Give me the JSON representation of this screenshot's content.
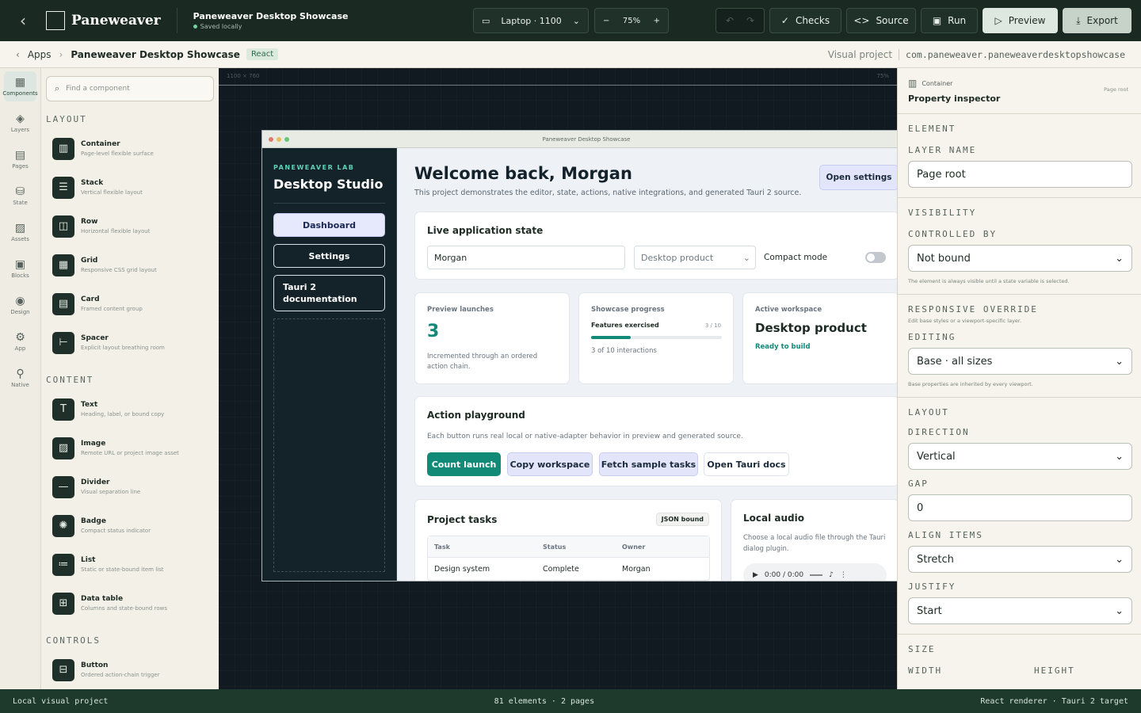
{
  "topbar": {
    "brand": "Paneweaver",
    "project_title": "Paneweaver Desktop Showcase",
    "save_status": "Saved locally",
    "viewport_select": "Laptop · 1100",
    "zoom": "75%",
    "checks_label": "Checks",
    "source_label": "Source",
    "run_label": "Run",
    "preview_label": "Preview",
    "export_label": "Export"
  },
  "crumbs": {
    "apps": "Apps",
    "project": "Paneweaver Desktop Showcase",
    "framework_tag": "React",
    "kind": "Visual project",
    "bundle_id": "com.paneweaver.paneweaverdesktopshowcase"
  },
  "rail": [
    {
      "icon": "components-icon",
      "label": "Components"
    },
    {
      "icon": "layers-icon",
      "label": "Layers"
    },
    {
      "icon": "pages-icon",
      "label": "Pages"
    },
    {
      "icon": "state-icon",
      "label": "State"
    },
    {
      "icon": "assets-icon",
      "label": "Assets"
    },
    {
      "icon": "blocks-icon",
      "label": "Blocks"
    },
    {
      "icon": "design-icon",
      "label": "Design"
    },
    {
      "icon": "app-icon",
      "label": "App"
    },
    {
      "icon": "native-icon",
      "label": "Native"
    }
  ],
  "palette": {
    "search_placeholder": "Find a component",
    "sections": [
      {
        "title": "LAYOUT",
        "items": [
          {
            "name": "Container",
            "desc": "Page-level flexible surface",
            "icon": "container-icon"
          },
          {
            "name": "Stack",
            "desc": "Vertical flexible layout",
            "icon": "stack-icon"
          },
          {
            "name": "Row",
            "desc": "Horizontal flexible layout",
            "icon": "row-icon"
          },
          {
            "name": "Grid",
            "desc": "Responsive CSS grid layout",
            "icon": "grid-icon"
          },
          {
            "name": "Card",
            "desc": "Framed content group",
            "icon": "card-icon"
          },
          {
            "name": "Spacer",
            "desc": "Explicit layout breathing room",
            "icon": "spacer-icon"
          }
        ]
      },
      {
        "title": "CONTENT",
        "items": [
          {
            "name": "Text",
            "desc": "Heading, label, or bound copy",
            "icon": "text-icon"
          },
          {
            "name": "Image",
            "desc": "Remote URL or project image asset",
            "icon": "image-icon"
          },
          {
            "name": "Divider",
            "desc": "Visual separation line",
            "icon": "divider-icon"
          },
          {
            "name": "Badge",
            "desc": "Compact status indicator",
            "icon": "badge-icon"
          },
          {
            "name": "List",
            "desc": "Static or state-bound item list",
            "icon": "list-icon"
          },
          {
            "name": "Data table",
            "desc": "Columns and state-bound rows",
            "icon": "table-icon"
          }
        ]
      },
      {
        "title": "CONTROLS",
        "items": [
          {
            "name": "Button",
            "desc": "Ordered action-chain trigger",
            "icon": "button-icon"
          }
        ]
      }
    ]
  },
  "canvas": {
    "size_label": "1100 × 760",
    "zoom_label": "75%",
    "window_title": "Paneweaver Desktop Showcase",
    "sidebar": {
      "eyebrow": "PANEWEAVER LAB",
      "title": "Desktop Studio",
      "nav": [
        "Dashboard",
        "Settings",
        "Tauri 2 documentation"
      ]
    },
    "header": {
      "title": "Welcome back, Morgan",
      "subtitle": "This project demonstrates the editor, state, actions, native integrations, and generated Tauri 2 source.",
      "settings_button": "Open settings"
    },
    "live_state": {
      "title": "Live application state",
      "name_value": "Morgan",
      "product_select": "Desktop product",
      "compact_label": "Compact mode",
      "compact_on": false
    },
    "stats": {
      "launches_label": "Preview launches",
      "launches_value": "3",
      "launches_desc": "Incremented through an ordered action chain.",
      "progress_label": "Showcase progress",
      "features_label": "Features exercised",
      "progress_value": "3 / 10",
      "progress_fraction": 0.3,
      "progress_desc": "3 of 10 interactions",
      "workspace_label": "Active workspace",
      "workspace_value": "Desktop product",
      "workspace_status": "Ready to build"
    },
    "actions": {
      "title": "Action playground",
      "desc": "Each button runs real local or native-adapter behavior in preview and generated source.",
      "buttons": [
        "Count launch",
        "Copy workspace",
        "Fetch sample tasks",
        "Open Tauri docs"
      ]
    },
    "tasks": {
      "title": "Project tasks",
      "badge": "JSON bound",
      "columns": [
        "Task",
        "Status",
        "Owner"
      ],
      "rows": [
        [
          "Design system",
          "Complete",
          "Morgan"
        ]
      ]
    },
    "audio": {
      "title": "Local audio",
      "desc": "Choose a local audio file through the Tauri dialog plugin.",
      "time": "0:00 / 0:00"
    }
  },
  "inspector": {
    "kind": "Container",
    "title": "Property inspector",
    "scope": "Page root",
    "element_label": "ELEMENT",
    "layer_name_label": "LAYER NAME",
    "layer_name_value": "Page root",
    "visibility_label": "VISIBILITY",
    "controlled_by_label": "CONTROLLED BY",
    "controlled_by_value": "Not bound",
    "visibility_hint": "The element is always visible until a state variable is selected.",
    "responsive_label": "RESPONSIVE OVERRIDE",
    "responsive_hint": "Edit base styles or a viewport-specific layer.",
    "editing_label": "EDITING",
    "editing_value": "Base · all sizes",
    "editing_hint": "Base properties are inherited by every viewport.",
    "layout_label": "LAYOUT",
    "direction_label": "DIRECTION",
    "direction_value": "Vertical",
    "gap_label": "GAP",
    "gap_value": "0",
    "align_label": "ALIGN ITEMS",
    "align_value": "Stretch",
    "justify_label": "JUSTIFY",
    "justify_value": "Start",
    "size_label": "SIZE",
    "width_label": "WIDTH",
    "height_label": "HEIGHT"
  },
  "status": {
    "left": "Local visual project",
    "center": "81 elements · 2 pages",
    "right": "React renderer · Tauri 2 target"
  },
  "colors": {
    "topbar": "#1a2a23",
    "accent_teal": "#128a78",
    "statusbar": "#1d3a2c"
  }
}
